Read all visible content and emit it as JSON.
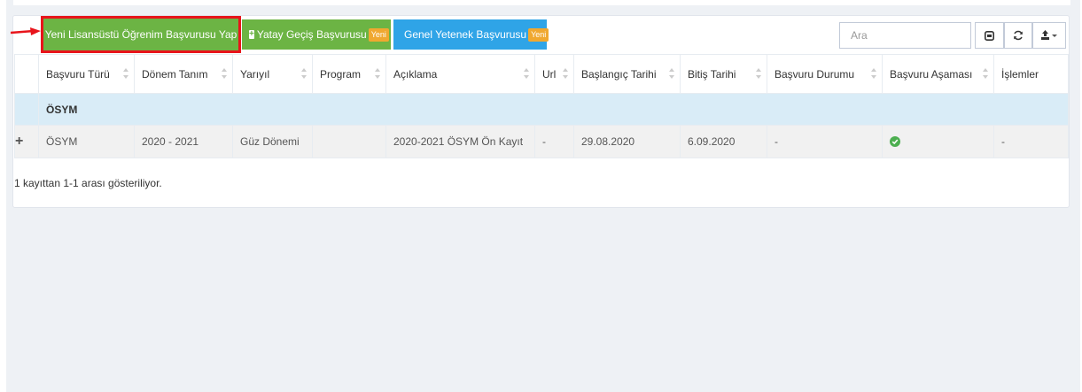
{
  "toolbar": {
    "new_application_label": "Yeni Lisansüstü Öğrenim Başvurusu Yap",
    "transfer_application_label": "Yatay Geçiş Başvurusu",
    "transfer_badge": "Yeni",
    "talent_application_label": "Genel Yetenek Başvurusu",
    "talent_badge": "Yeni",
    "search_placeholder": "Ara"
  },
  "table": {
    "columns": [
      "Başvuru Türü",
      "Dönem Tanım",
      "Yarıyıl",
      "Program",
      "Açıklama",
      "Url",
      "Başlangıç Tarihi",
      "Bitiş Tarihi",
      "Başvuru Durumu",
      "Başvuru Aşaması",
      "İşlemler"
    ],
    "group_label": "ÖSYM",
    "rows": [
      {
        "expand": "+",
        "cells": [
          "ÖSYM",
          "2020 - 2021",
          "Güz Dönemi",
          "",
          "2020-2021 ÖSYM Ön Kayıt",
          "-",
          "29.08.2020",
          "6.09.2020",
          "-",
          "",
          "-"
        ],
        "stage_icon": "check-circle-icon"
      }
    ]
  },
  "pagination_info": "1 kayıttan 1-1 arası gösteriliyor.",
  "icons": {
    "toggle": "toggle-columns-icon",
    "refresh": "refresh-icon",
    "export": "export-icon"
  },
  "colors": {
    "green": "#6cb444",
    "blue": "#2fa4e7",
    "badge": "#f0a830",
    "highlight": "#e8141b",
    "group_row": "#d9ecf7"
  }
}
